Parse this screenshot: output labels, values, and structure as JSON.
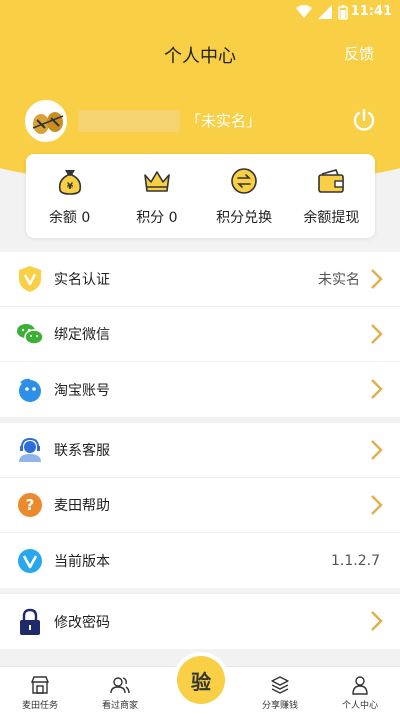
{
  "status_bar": {
    "time": "11:41"
  },
  "header": {
    "title": "个人中心",
    "feedback": "反馈",
    "realname_status": "「未实名」"
  },
  "stats": [
    {
      "label": "余额 0",
      "icon": "money-bag-icon"
    },
    {
      "label": "积分 0",
      "icon": "crown-icon"
    },
    {
      "label": "积分兑换",
      "icon": "exchange-icon"
    },
    {
      "label": "余额提现",
      "icon": "wallet-icon"
    }
  ],
  "list_group_1": [
    {
      "label": "实名认证",
      "value": "未实名",
      "icon": "verified-v-icon"
    },
    {
      "label": "绑定微信",
      "value": "",
      "icon": "wechat-icon"
    },
    {
      "label": "淘宝账号",
      "value": "",
      "icon": "taobao-icon"
    }
  ],
  "list_group_2": [
    {
      "label": "联系客服",
      "value": "",
      "icon": "customer-service-icon"
    },
    {
      "label": "麦田帮助",
      "value": "",
      "icon": "help-question-icon"
    },
    {
      "label": "当前版本",
      "value": "1.1.2.7",
      "icon": "version-v-icon"
    }
  ],
  "list_group_3": [
    {
      "label": "修改密码",
      "value": "",
      "icon": "lock-icon"
    }
  ],
  "tabbar": [
    {
      "label": "麦田任务",
      "icon": "store-icon"
    },
    {
      "label": "看过商家",
      "icon": "users-icon"
    },
    {
      "label": "",
      "icon": ""
    },
    {
      "label": "分享赚钱",
      "icon": "layers-icon"
    },
    {
      "label": "个人中心",
      "icon": "person-icon"
    }
  ],
  "center_button": {
    "label": "验"
  },
  "colors": {
    "accent": "#f8cf45",
    "chevron": "#e0b04c"
  }
}
